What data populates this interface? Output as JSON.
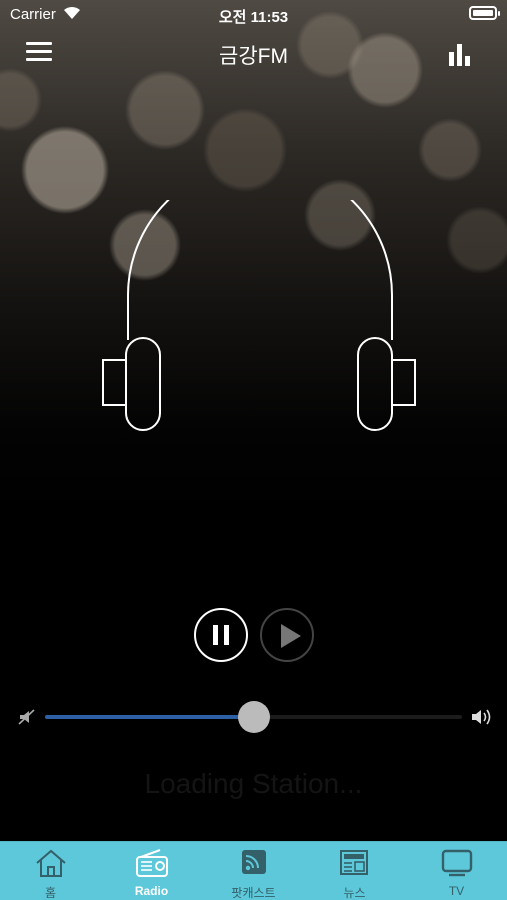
{
  "status_bar": {
    "carrier": "Carrier",
    "time": "오전 11:53",
    "wifi_icon": "wifi-icon",
    "battery_icon": "battery-icon"
  },
  "nav": {
    "title": "금강FM",
    "menu_icon": "hamburger-menu-icon",
    "equalizer_icon": "equalizer-icon"
  },
  "artwork": {
    "icon": "headphones-icon"
  },
  "player": {
    "pause_icon": "pause-icon",
    "play_icon": "play-icon",
    "volume_level": 0.5,
    "volume_fill_color": "#2d5fa4",
    "status_text": "Loading Station..."
  },
  "tab_bar": {
    "background_color": "#5dc8d9",
    "active_index": 1,
    "tabs": [
      {
        "label": "홈",
        "icon": "home-icon"
      },
      {
        "label": "Radio",
        "icon": "radio-icon"
      },
      {
        "label": "팟캐스트",
        "icon": "podcast-rss-icon"
      },
      {
        "label": "뉴스",
        "icon": "newspaper-icon"
      },
      {
        "label": "TV",
        "icon": "tv-icon"
      }
    ]
  }
}
